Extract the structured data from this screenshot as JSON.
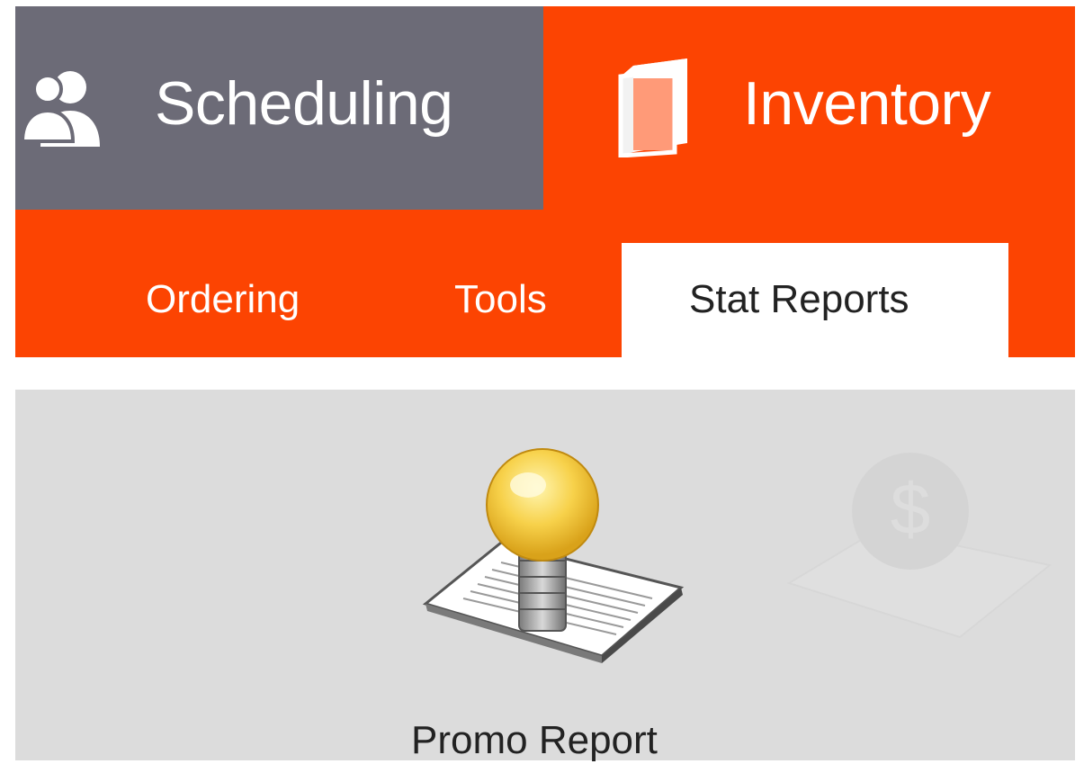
{
  "top_tabs": [
    {
      "label": "Scheduling",
      "icon": "people-icon",
      "active": false,
      "color": "#6c6b77"
    },
    {
      "label": "Inventory",
      "icon": "book-icon",
      "active": true,
      "color": "#fc4402"
    }
  ],
  "sub_tabs": [
    {
      "label": "Ordering",
      "active": false
    },
    {
      "label": "Tools",
      "active": false
    },
    {
      "label": "Stat Reports",
      "active": true
    }
  ],
  "reports": [
    {
      "label": "Promo Report",
      "icon": "lightbulb-report-icon",
      "enabled": true
    },
    {
      "label": "",
      "icon": "dollar-report-icon",
      "enabled": false
    }
  ],
  "colors": {
    "accent": "#fc4402",
    "inactive_tab": "#6c6b77",
    "content_bg": "#dcdcdc"
  }
}
